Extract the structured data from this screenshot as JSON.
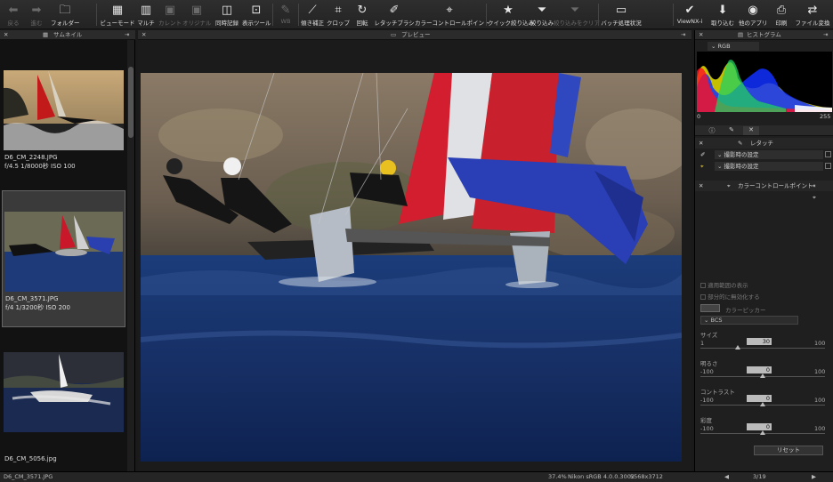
{
  "toolbar": {
    "items": [
      {
        "label": "戻る",
        "icon": "back-arrow"
      },
      {
        "label": "進む",
        "icon": "forward-arrow"
      },
      {
        "label": "フォルダー",
        "icon": "folder"
      },
      {
        "label": "ビューモード",
        "icon": "view-mode"
      },
      {
        "label": "マルチ",
        "icon": "multi"
      },
      {
        "label": "カレント",
        "icon": "current"
      },
      {
        "label": "オリジナル",
        "icon": "original"
      },
      {
        "label": "同時記録",
        "icon": "simultaneous"
      },
      {
        "label": "表示ツール",
        "icon": "display-tools"
      },
      {
        "label": "WB",
        "icon": "white-balance"
      },
      {
        "label": "傾き補正",
        "icon": "straighten"
      },
      {
        "label": "クロップ",
        "icon": "crop"
      },
      {
        "label": "回転",
        "icon": "rotate"
      },
      {
        "label": "レタッチブラシ",
        "icon": "retouch-brush"
      },
      {
        "label": "カラーコントロールポイント",
        "icon": "color-control-point"
      },
      {
        "label": "クイック絞り込み",
        "icon": "star"
      },
      {
        "label": "絞り込み",
        "icon": "filter"
      },
      {
        "label": "絞り込みをクリア",
        "icon": "filter-clear"
      },
      {
        "label": "バッチ処理状況",
        "icon": "batch"
      },
      {
        "label": "ViewNX-i",
        "icon": "viewnx"
      },
      {
        "label": "取り込む",
        "icon": "import"
      },
      {
        "label": "他のアプリ",
        "icon": "other-apps"
      },
      {
        "label": "印刷",
        "icon": "print"
      },
      {
        "label": "ファイル変換",
        "icon": "convert"
      }
    ]
  },
  "thumbnails": {
    "title": "サムネイル",
    "items": [
      {
        "name": "D6_CM_2248.JPG",
        "info": "f/4.5 1/8000秒 ISO 100"
      },
      {
        "name": "D6_CM_3571.JPG",
        "info": "f/4 1/3200秒 ISO 200"
      },
      {
        "name": "D6_CM_5056.jpg",
        "info": ""
      }
    ]
  },
  "preview": {
    "title": "プレビュー"
  },
  "histogram": {
    "title": "ヒストグラム",
    "channel": "RGB",
    "min": "0",
    "max": "255"
  },
  "adjust": {
    "retouch_title": "レタッチ",
    "row1": "撮影時の設定",
    "row2": "撮影時の設定",
    "ccp_title": "カラーコントロールポイント",
    "show_range": "適用範囲の表示",
    "disable_partial": "部分的に無効化する",
    "picker": "カラーピッカー",
    "mode": "BCS",
    "sliders": [
      {
        "label": "サイズ",
        "min": "1",
        "max": "100",
        "value": "30",
        "level": 0.3
      },
      {
        "label": "明るさ",
        "min": "-100",
        "max": "100",
        "value": "0",
        "level": 0.5
      },
      {
        "label": "コントラスト",
        "min": "-100",
        "max": "100",
        "value": "0",
        "level": 0.5
      },
      {
        "label": "彩度",
        "min": "-100",
        "max": "100",
        "value": "0",
        "level": 0.5
      }
    ],
    "reset": "リセット"
  },
  "status": {
    "filename": "D6_CM_3571.JPG",
    "zoom": "37.4%",
    "profile": "Nikon sRGB 4.0.0.3002",
    "dimensions": "5568x3712",
    "page": "3/19"
  },
  "colors": {
    "accent": "#e8d040",
    "bg": "#1a1a1a"
  }
}
